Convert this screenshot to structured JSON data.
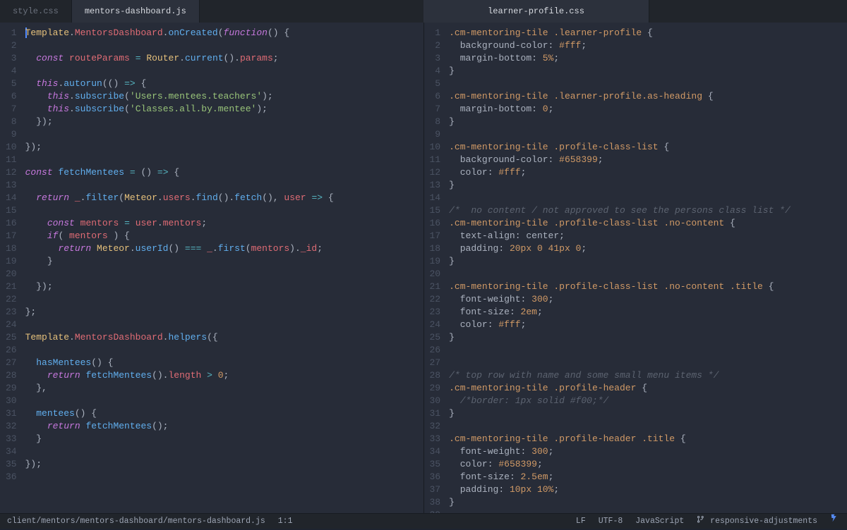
{
  "tabs": {
    "left": [
      {
        "label": "style.css",
        "active": false
      },
      {
        "label": "mentors-dashboard.js",
        "active": true
      }
    ],
    "right": [
      {
        "label": "learner-profile.css",
        "active": true
      }
    ]
  },
  "status": {
    "path": "client/mentors/mentors-dashboard/mentors-dashboard.js",
    "cursor": "1:1",
    "eol": "LF",
    "encoding": "UTF-8",
    "language": "JavaScript",
    "branch": "responsive-adjustments"
  },
  "left_pane": {
    "language": "javascript",
    "lines": [
      [
        [
          "obj",
          "Template"
        ],
        [
          "pun",
          "."
        ],
        [
          "var",
          "MentorsDashboard"
        ],
        [
          "pun",
          "."
        ],
        [
          "fn",
          "onCreated"
        ],
        [
          "pun",
          "("
        ],
        [
          "kw",
          "function"
        ],
        [
          "pun",
          "() {"
        ]
      ],
      [],
      [
        [
          "pun",
          "  "
        ],
        [
          "kw",
          "const"
        ],
        [
          "pun",
          " "
        ],
        [
          "var",
          "routeParams"
        ],
        [
          "pun",
          " "
        ],
        [
          "op",
          "="
        ],
        [
          "pun",
          " "
        ],
        [
          "obj",
          "Router"
        ],
        [
          "pun",
          "."
        ],
        [
          "fn",
          "current"
        ],
        [
          "pun",
          "()."
        ],
        [
          "var",
          "params"
        ],
        [
          "pun",
          ";"
        ]
      ],
      [],
      [
        [
          "pun",
          "  "
        ],
        [
          "kw",
          "this"
        ],
        [
          "pun",
          "."
        ],
        [
          "fn",
          "autorun"
        ],
        [
          "pun",
          "(() "
        ],
        [
          "op",
          "=>"
        ],
        [
          "pun",
          " {"
        ]
      ],
      [
        [
          "pun",
          "    "
        ],
        [
          "kw",
          "this"
        ],
        [
          "pun",
          "."
        ],
        [
          "fn",
          "subscribe"
        ],
        [
          "pun",
          "("
        ],
        [
          "str",
          "'Users.mentees.teachers'"
        ],
        [
          "pun",
          ");"
        ]
      ],
      [
        [
          "pun",
          "    "
        ],
        [
          "kw",
          "this"
        ],
        [
          "pun",
          "."
        ],
        [
          "fn",
          "subscribe"
        ],
        [
          "pun",
          "("
        ],
        [
          "str",
          "'Classes.all.by.mentee'"
        ],
        [
          "pun",
          ");"
        ]
      ],
      [
        [
          "pun",
          "  });"
        ]
      ],
      [],
      [
        [
          "pun",
          "});"
        ]
      ],
      [],
      [
        [
          "kw",
          "const"
        ],
        [
          "pun",
          " "
        ],
        [
          "fn",
          "fetchMentees"
        ],
        [
          "pun",
          " "
        ],
        [
          "op",
          "="
        ],
        [
          "pun",
          " () "
        ],
        [
          "op",
          "=>"
        ],
        [
          "pun",
          " {"
        ]
      ],
      [],
      [
        [
          "pun",
          "  "
        ],
        [
          "kw",
          "return"
        ],
        [
          "pun",
          " "
        ],
        [
          "var",
          "_"
        ],
        [
          "pun",
          "."
        ],
        [
          "fn",
          "filter"
        ],
        [
          "pun",
          "("
        ],
        [
          "obj",
          "Meteor"
        ],
        [
          "pun",
          "."
        ],
        [
          "var",
          "users"
        ],
        [
          "pun",
          "."
        ],
        [
          "fn",
          "find"
        ],
        [
          "pun",
          "()."
        ],
        [
          "fn",
          "fetch"
        ],
        [
          "pun",
          "(), "
        ],
        [
          "var",
          "user"
        ],
        [
          "pun",
          " "
        ],
        [
          "op",
          "=>"
        ],
        [
          "pun",
          " {"
        ]
      ],
      [],
      [
        [
          "pun",
          "    "
        ],
        [
          "kw",
          "const"
        ],
        [
          "pun",
          " "
        ],
        [
          "var",
          "mentors"
        ],
        [
          "pun",
          " "
        ],
        [
          "op",
          "="
        ],
        [
          "pun",
          " "
        ],
        [
          "var",
          "user"
        ],
        [
          "pun",
          "."
        ],
        [
          "var",
          "mentors"
        ],
        [
          "pun",
          ";"
        ]
      ],
      [
        [
          "pun",
          "    "
        ],
        [
          "kw",
          "if"
        ],
        [
          "pun",
          "( "
        ],
        [
          "var",
          "mentors"
        ],
        [
          "pun",
          " ) {"
        ]
      ],
      [
        [
          "pun",
          "      "
        ],
        [
          "kw",
          "return"
        ],
        [
          "pun",
          " "
        ],
        [
          "obj",
          "Meteor"
        ],
        [
          "pun",
          "."
        ],
        [
          "fn",
          "userId"
        ],
        [
          "pun",
          "() "
        ],
        [
          "op",
          "==="
        ],
        [
          "pun",
          " "
        ],
        [
          "var",
          "_"
        ],
        [
          "pun",
          "."
        ],
        [
          "fn",
          "first"
        ],
        [
          "pun",
          "("
        ],
        [
          "var",
          "mentors"
        ],
        [
          "pun",
          ")."
        ],
        [
          "var",
          "_id"
        ],
        [
          "pun",
          ";"
        ]
      ],
      [
        [
          "pun",
          "    }"
        ]
      ],
      [],
      [
        [
          "pun",
          "  });"
        ]
      ],
      [],
      [
        [
          "pun",
          "};"
        ]
      ],
      [],
      [
        [
          "obj",
          "Template"
        ],
        [
          "pun",
          "."
        ],
        [
          "var",
          "MentorsDashboard"
        ],
        [
          "pun",
          "."
        ],
        [
          "fn",
          "helpers"
        ],
        [
          "pun",
          "({"
        ]
      ],
      [],
      [
        [
          "pun",
          "  "
        ],
        [
          "fn",
          "hasMentees"
        ],
        [
          "pun",
          "() {"
        ]
      ],
      [
        [
          "pun",
          "    "
        ],
        [
          "kw",
          "return"
        ],
        [
          "pun",
          " "
        ],
        [
          "fn",
          "fetchMentees"
        ],
        [
          "pun",
          "()."
        ],
        [
          "var",
          "length"
        ],
        [
          "pun",
          " "
        ],
        [
          "op",
          ">"
        ],
        [
          "pun",
          " "
        ],
        [
          "num",
          "0"
        ],
        [
          "pun",
          ";"
        ]
      ],
      [
        [
          "pun",
          "  },"
        ]
      ],
      [],
      [
        [
          "pun",
          "  "
        ],
        [
          "fn",
          "mentees"
        ],
        [
          "pun",
          "() {"
        ]
      ],
      [
        [
          "pun",
          "    "
        ],
        [
          "kw",
          "return"
        ],
        [
          "pun",
          " "
        ],
        [
          "fn",
          "fetchMentees"
        ],
        [
          "pun",
          "();"
        ]
      ],
      [
        [
          "pun",
          "  }"
        ]
      ],
      [],
      [
        [
          "pun",
          "});"
        ]
      ],
      []
    ]
  },
  "right_pane": {
    "language": "css",
    "lines": [
      [
        [
          "sel",
          ".cm-mentoring-tile"
        ],
        [
          "pun",
          " "
        ],
        [
          "sel",
          ".learner-profile"
        ],
        [
          "pun",
          " {"
        ]
      ],
      [
        [
          "pun",
          "  "
        ],
        [
          "white",
          "background-color"
        ],
        [
          "pun",
          ": "
        ],
        [
          "val",
          "#fff"
        ],
        [
          "pun",
          ";"
        ]
      ],
      [
        [
          "pun",
          "  "
        ],
        [
          "white",
          "margin-bottom"
        ],
        [
          "pun",
          ": "
        ],
        [
          "val",
          "5%"
        ],
        [
          "pun",
          ";"
        ]
      ],
      [
        [
          "pun",
          "}"
        ]
      ],
      [],
      [
        [
          "sel",
          ".cm-mentoring-tile"
        ],
        [
          "pun",
          " "
        ],
        [
          "sel",
          ".learner-profile"
        ],
        [
          "sel",
          ".as-heading"
        ],
        [
          "pun",
          " {"
        ]
      ],
      [
        [
          "pun",
          "  "
        ],
        [
          "white",
          "margin-bottom"
        ],
        [
          "pun",
          ": "
        ],
        [
          "val",
          "0"
        ],
        [
          "pun",
          ";"
        ]
      ],
      [
        [
          "pun",
          "}"
        ]
      ],
      [],
      [
        [
          "sel",
          ".cm-mentoring-tile"
        ],
        [
          "pun",
          " "
        ],
        [
          "sel",
          ".profile-class-list"
        ],
        [
          "pun",
          " {"
        ]
      ],
      [
        [
          "pun",
          "  "
        ],
        [
          "white",
          "background-color"
        ],
        [
          "pun",
          ": "
        ],
        [
          "val",
          "#658399"
        ],
        [
          "pun",
          ";"
        ]
      ],
      [
        [
          "pun",
          "  "
        ],
        [
          "white",
          "color"
        ],
        [
          "pun",
          ": "
        ],
        [
          "val",
          "#fff"
        ],
        [
          "pun",
          ";"
        ]
      ],
      [
        [
          "pun",
          "}"
        ]
      ],
      [],
      [
        [
          "cmt",
          "/*  no content / not approved to see the persons class list */"
        ]
      ],
      [
        [
          "sel",
          ".cm-mentoring-tile"
        ],
        [
          "pun",
          " "
        ],
        [
          "sel",
          ".profile-class-list"
        ],
        [
          "pun",
          " "
        ],
        [
          "sel",
          ".no-content"
        ],
        [
          "pun",
          " {"
        ]
      ],
      [
        [
          "pun",
          "  "
        ],
        [
          "white",
          "text-align"
        ],
        [
          "pun",
          ": "
        ],
        [
          "white",
          "center"
        ],
        [
          "pun",
          ";"
        ]
      ],
      [
        [
          "pun",
          "  "
        ],
        [
          "white",
          "padding"
        ],
        [
          "pun",
          ": "
        ],
        [
          "val",
          "20px 0 41px 0"
        ],
        [
          "pun",
          ";"
        ]
      ],
      [
        [
          "pun",
          "}"
        ]
      ],
      [],
      [
        [
          "sel",
          ".cm-mentoring-tile"
        ],
        [
          "pun",
          " "
        ],
        [
          "sel",
          ".profile-class-list"
        ],
        [
          "pun",
          " "
        ],
        [
          "sel",
          ".no-content"
        ],
        [
          "pun",
          " "
        ],
        [
          "sel",
          ".title"
        ],
        [
          "pun",
          " {"
        ]
      ],
      [
        [
          "pun",
          "  "
        ],
        [
          "white",
          "font-weight"
        ],
        [
          "pun",
          ": "
        ],
        [
          "val",
          "300"
        ],
        [
          "pun",
          ";"
        ]
      ],
      [
        [
          "pun",
          "  "
        ],
        [
          "white",
          "font-size"
        ],
        [
          "pun",
          ": "
        ],
        [
          "val",
          "2em"
        ],
        [
          "pun",
          ";"
        ]
      ],
      [
        [
          "pun",
          "  "
        ],
        [
          "white",
          "color"
        ],
        [
          "pun",
          ": "
        ],
        [
          "val",
          "#fff"
        ],
        [
          "pun",
          ";"
        ]
      ],
      [
        [
          "pun",
          "}"
        ]
      ],
      [],
      [],
      [
        [
          "cmt",
          "/* top row with name and some small menu items */"
        ]
      ],
      [
        [
          "sel",
          ".cm-mentoring-tile"
        ],
        [
          "pun",
          " "
        ],
        [
          "sel",
          ".profile-header"
        ],
        [
          "pun",
          " {"
        ]
      ],
      [
        [
          "pun",
          "  "
        ],
        [
          "cmt",
          "/*border: 1px solid #f00;*/"
        ]
      ],
      [
        [
          "pun",
          "}"
        ]
      ],
      [],
      [
        [
          "sel",
          ".cm-mentoring-tile"
        ],
        [
          "pun",
          " "
        ],
        [
          "sel",
          ".profile-header"
        ],
        [
          "pun",
          " "
        ],
        [
          "sel",
          ".title"
        ],
        [
          "pun",
          " {"
        ]
      ],
      [
        [
          "pun",
          "  "
        ],
        [
          "white",
          "font-weight"
        ],
        [
          "pun",
          ": "
        ],
        [
          "val",
          "300"
        ],
        [
          "pun",
          ";"
        ]
      ],
      [
        [
          "pun",
          "  "
        ],
        [
          "white",
          "color"
        ],
        [
          "pun",
          ": "
        ],
        [
          "val",
          "#658399"
        ],
        [
          "pun",
          ";"
        ]
      ],
      [
        [
          "pun",
          "  "
        ],
        [
          "white",
          "font-size"
        ],
        [
          "pun",
          ": "
        ],
        [
          "val",
          "2.5em"
        ],
        [
          "pun",
          ";"
        ]
      ],
      [
        [
          "pun",
          "  "
        ],
        [
          "white",
          "padding"
        ],
        [
          "pun",
          ": "
        ],
        [
          "val",
          "10px 10%"
        ],
        [
          "pun",
          ";"
        ]
      ],
      [
        [
          "pun",
          "}"
        ]
      ],
      []
    ]
  }
}
